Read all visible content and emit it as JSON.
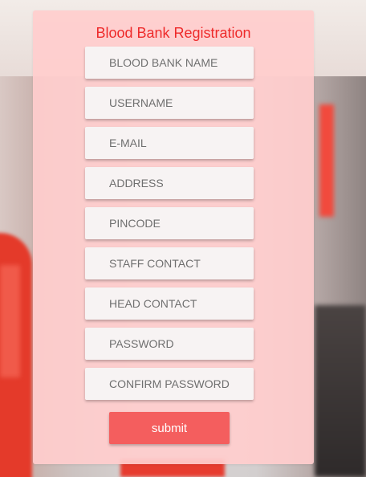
{
  "form": {
    "title": "Blood Bank Registration",
    "fields": [
      {
        "placeholder": "BLOOD BANK NAME",
        "value": ""
      },
      {
        "placeholder": "USERNAME",
        "value": ""
      },
      {
        "placeholder": "E-MAIL",
        "value": ""
      },
      {
        "placeholder": "ADDRESS",
        "value": ""
      },
      {
        "placeholder": "PINCODE",
        "value": ""
      },
      {
        "placeholder": "STAFF CONTACT",
        "value": ""
      },
      {
        "placeholder": "HEAD CONTACT",
        "value": ""
      },
      {
        "placeholder": "PASSWORD",
        "value": ""
      },
      {
        "placeholder": "CONFIRM PASSWORD",
        "value": ""
      }
    ],
    "submit_label": "submit"
  },
  "colors": {
    "title": "#ee2a2a",
    "card_background": "#ffcdcd",
    "submit_background": "#f45e5e"
  }
}
